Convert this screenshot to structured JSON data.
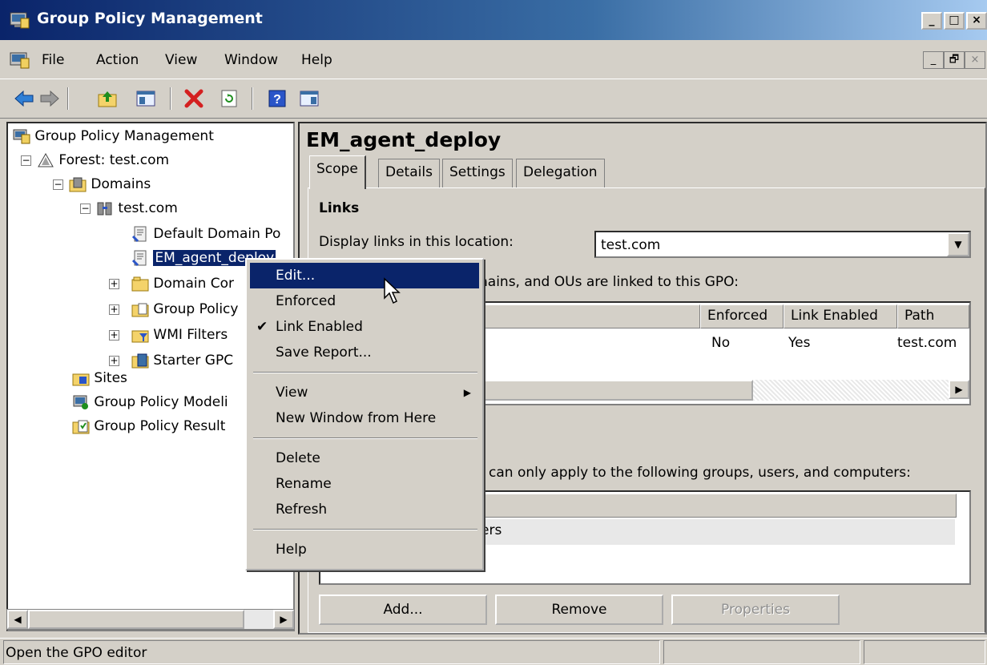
{
  "window": {
    "title": "Group Policy Management",
    "caption_buttons": [
      "_",
      "□",
      "×"
    ]
  },
  "menubar": {
    "items": [
      "File",
      "Action",
      "View",
      "Window",
      "Help"
    ],
    "mdi_buttons": [
      "_",
      "🗗",
      "×"
    ]
  },
  "toolbar": {
    "icons": [
      "back-arrow-icon",
      "forward-arrow-icon",
      "up-folder-icon",
      "show-hide-tree-icon",
      "delete-icon",
      "refresh-icon",
      "help-icon",
      "action-pane-icon"
    ]
  },
  "tree": {
    "nodes": [
      {
        "label": "Group Policy Management",
        "icon": "gpm-console-icon"
      },
      {
        "label": "Forest: test.com",
        "icon": "forest-icon",
        "expander": "−"
      },
      {
        "label": "Domains",
        "icon": "domains-icon",
        "expander": "−"
      },
      {
        "label": "test.com",
        "icon": "domain-icon",
        "expander": "−"
      },
      {
        "label": "Default Domain Po",
        "icon": "gpo-link-icon"
      },
      {
        "label": "EM_agent_deploy",
        "icon": "gpo-link-icon"
      },
      {
        "label": "Domain Cor",
        "icon": "ou-folder-icon",
        "expander": "+"
      },
      {
        "label": "Group Policy",
        "icon": "gpo-folder-icon",
        "expander": "+"
      },
      {
        "label": "WMI Filters",
        "icon": "wmi-folder-icon",
        "expander": "+"
      },
      {
        "label": "Starter GPC",
        "icon": "starter-gpo-icon",
        "expander": "+"
      },
      {
        "label": "Sites",
        "icon": "sites-icon"
      },
      {
        "label": "Group Policy Modeli",
        "icon": "modeling-icon"
      },
      {
        "label": "Group Policy Result",
        "icon": "results-icon"
      }
    ]
  },
  "details": {
    "gpo_name": "EM_agent_deploy",
    "tabs": [
      "Scope",
      "Details",
      "Settings",
      "Delegation"
    ],
    "active_tab": "Scope",
    "links_heading": "Links",
    "display_links_label": "Display links in this location:",
    "location_value": "test.com",
    "linked_text": "nains, and OUs are linked to this GPO:",
    "link_columns": [
      "Enforced",
      "Link Enabled",
      "Path"
    ],
    "link_row": {
      "enforced": "No",
      "link_enabled": "Yes",
      "path": "test.com"
    },
    "filter_text": ") can only apply to the following groups, users, and computers:",
    "filter_row": "ers",
    "buttons": {
      "add": "Add...",
      "remove": "Remove",
      "properties": "Properties"
    }
  },
  "context_menu": {
    "items": [
      {
        "label": "Edit...",
        "highlighted": true
      },
      {
        "label": "Enforced"
      },
      {
        "label": "Link Enabled",
        "checked": true
      },
      {
        "label": "Save Report..."
      },
      {
        "label": "View",
        "submenu": true
      },
      {
        "label": "New Window from Here"
      },
      {
        "label": "Delete"
      },
      {
        "label": "Rename"
      },
      {
        "label": "Refresh"
      },
      {
        "label": "Help"
      }
    ],
    "check_glyph": "✔",
    "submenu_glyph": "▶"
  },
  "statusbar": {
    "text": "Open the GPO editor"
  },
  "colors": {
    "title_active": "#0a246a",
    "face": "#d4d0c8",
    "highlight": "#0a246a"
  }
}
